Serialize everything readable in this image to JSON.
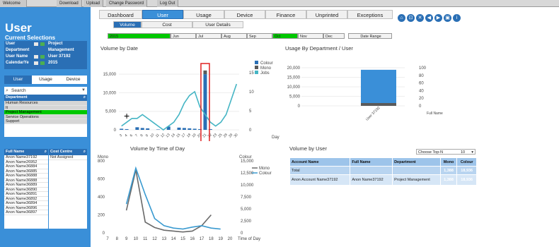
{
  "topbar": {
    "items": [
      "Welcome",
      "Download",
      "Upload",
      "Change Password",
      "Log Out"
    ]
  },
  "sidebar": {
    "title": "User",
    "subtitle": "Current Selections",
    "selections": [
      {
        "key": "User",
        "value": "Project"
      },
      {
        "key": "Department",
        "value": "Management"
      },
      {
        "key": "User Name",
        "value": "User 37192"
      },
      {
        "key": "CalendarYe",
        "value": "2015"
      }
    ],
    "tabs": [
      "User",
      "Usage",
      "Device"
    ],
    "search_placeholder": "Search",
    "department": {
      "header": "Department",
      "items": [
        "Human Resources",
        "It",
        "Project Management",
        "Service Operations",
        "Support"
      ]
    },
    "fullname": {
      "header": "Full Name",
      "items": [
        "Anon Name37192",
        "Anon Name26952",
        "Anon Name36884",
        "Anon Name36885",
        "Anon Name36888",
        "Anon Name36888",
        "Anon Name36889",
        "Anon Name36890",
        "Anon Name36891",
        "Anon Name36892",
        "Anon Name36894",
        "Anon Name36896",
        "Anon Name36897"
      ]
    },
    "costcentre": {
      "header": "Cost Centre",
      "items": [
        "Not Assigned"
      ]
    }
  },
  "tabs": [
    "Dashboard",
    "User",
    "Usage",
    "Device",
    "Finance",
    "Unprinted",
    "Exceptions"
  ],
  "subtabs": [
    "Volume",
    "Cost",
    "User Details"
  ],
  "timeline": {
    "year": "2015",
    "months": [
      "Jun",
      "Jul",
      "Aug",
      "Sep",
      "Oct",
      "Nov",
      "Dec"
    ],
    "range_label": "Date Range"
  },
  "panels": {
    "volume_by_date": "Volume by Date",
    "usage_by_dept": "Usage By Department / User",
    "volume_by_time": "Volume by Time of Day",
    "volume_by_user": "Volume by User"
  },
  "chart_data": [
    {
      "type": "bar",
      "title": "Volume by Date",
      "xlabel": "Day",
      "ylim": [
        0,
        17500
      ],
      "y2lim": [
        0,
        17
      ],
      "categories": [
        "3",
        "4",
        "6",
        "7",
        "8",
        "9",
        "10",
        "11",
        "12",
        "13",
        "14",
        "15",
        "17",
        "18",
        "19",
        "20",
        "21",
        "22",
        "23",
        "25",
        "28",
        "29",
        "30"
      ],
      "series": [
        {
          "name": "Colour",
          "values": [
            300,
            200,
            0,
            700,
            500,
            400,
            0,
            100,
            0,
            900,
            0,
            600,
            500,
            400,
            300,
            200,
            15000,
            200,
            0,
            0,
            0,
            0,
            0
          ]
        },
        {
          "name": "Mono",
          "values": [
            0,
            0,
            0,
            0,
            0,
            0,
            0,
            0,
            0,
            0,
            0,
            0,
            0,
            0,
            0,
            0,
            1000,
            0,
            0,
            0,
            0,
            0,
            0
          ]
        },
        {
          "name": "Jobs",
          "values": [
            1,
            2,
            3,
            3,
            4,
            3,
            2,
            1,
            0,
            1,
            2,
            4,
            7,
            9,
            10,
            6,
            4,
            2,
            1,
            2,
            4,
            8,
            12
          ]
        }
      ],
      "ytick_labels": [
        "0",
        "5,000",
        "10,000",
        "15,000"
      ],
      "y2tick_labels": [
        "0",
        "5",
        "10",
        "15"
      ]
    },
    {
      "type": "bar",
      "title": "Usage By Department / User",
      "categories": [
        "User 37192"
      ],
      "series": [
        {
          "name": "Colour",
          "values": [
            18936
          ]
        },
        {
          "name": "Mono",
          "values": [
            1388
          ]
        }
      ],
      "ytick_labels": [
        "0",
        "5,000",
        "10,000",
        "15,000",
        "20,000"
      ],
      "y2tick_labels": [
        "0",
        "20",
        "40",
        "60",
        "80",
        "100"
      ],
      "xlabel": "Full Name"
    },
    {
      "type": "line",
      "title": "Volume by Time of Day",
      "xlabel": "Time of Day",
      "ylabel": "Mono",
      "y2label": "Colour",
      "x": [
        7,
        8,
        9,
        10,
        11,
        12,
        13,
        14,
        15,
        16,
        17,
        18,
        19,
        20
      ],
      "series": [
        {
          "name": "Mono",
          "values": [
            null,
            null,
            250,
            700,
            120,
            60,
            30,
            20,
            10,
            20,
            80,
            200,
            null,
            null
          ]
        },
        {
          "name": "Colour",
          "values": [
            null,
            null,
            6000,
            13500,
            8000,
            3000,
            1500,
            1000,
            800,
            1200,
            1500,
            1000,
            800,
            null
          ]
        }
      ],
      "ytick_labels": [
        "0",
        "200",
        "400",
        "600",
        "800"
      ],
      "y2tick_labels": [
        "0",
        "2,500",
        "5,000",
        "7,500",
        "10,000",
        "12,500",
        "15,000"
      ]
    }
  ],
  "volume_by_user": {
    "top_n_label": "Choose Top-N",
    "top_n_value": "10",
    "headers": [
      "Account Name",
      "Full Name",
      "Department",
      "Mono",
      "Colour"
    ],
    "total": {
      "label": "Total",
      "mono": "1,388",
      "colour": "18,936"
    },
    "rows": [
      {
        "account": "Anon Account Name37192",
        "fullname": "Anon Name37192",
        "department": "Project Management",
        "mono": "1,388",
        "colour": "18,936"
      }
    ]
  },
  "colors": {
    "accent": "#3a8fd8",
    "selected": "#00c800",
    "highlight": "#e02020"
  }
}
